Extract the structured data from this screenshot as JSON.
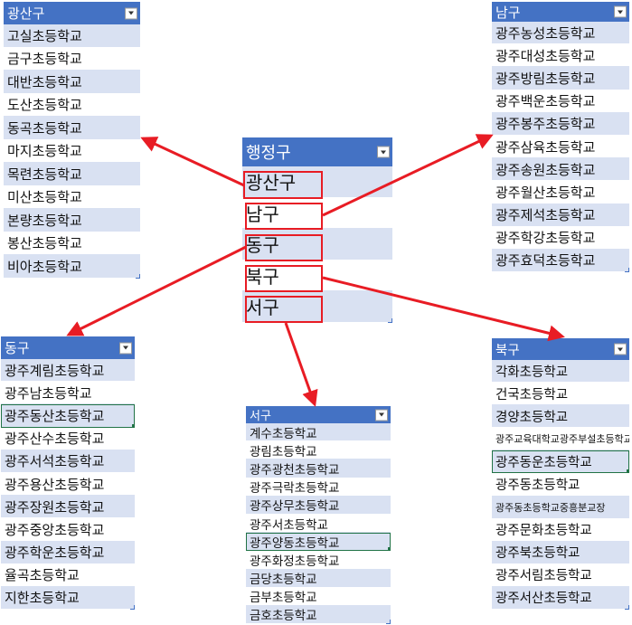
{
  "colors": {
    "header": "#4472c4",
    "band": "#d9e1f2",
    "arrow": "#e81c24",
    "selection": "#217346"
  },
  "icons": {
    "filter": "filter-dropdown-icon"
  },
  "tables": [
    {
      "id": "gwangsan",
      "header": "광산구",
      "rows": [
        "고실초등학교",
        "금구초등학교",
        "대반초등학교",
        "도산초등학교",
        "동곡초등학교",
        "마지초등학교",
        "목련초등학교",
        "미산초등학교",
        "본량초등학교",
        "봉산초등학교",
        "비아초등학교"
      ]
    },
    {
      "id": "nam",
      "header": "남구",
      "rows": [
        "광주농성초등학교",
        "광주대성초등학교",
        "광주방림초등학교",
        "광주백운초등학교",
        "광주봉주초등학교",
        "광주삼육초등학교",
        "광주송원초등학교",
        "광주월산초등학교",
        "광주제석초등학교",
        "광주학강초등학교",
        "광주효덕초등학교"
      ]
    },
    {
      "id": "district",
      "header": "행정구",
      "rows": [
        "광산구",
        "남구",
        "동구",
        "북구",
        "서구"
      ]
    },
    {
      "id": "dong",
      "header": "동구",
      "rows": [
        "광주계림초등학교",
        "광주남초등학교",
        "광주동산초등학교",
        "광주산수초등학교",
        "광주서석초등학교",
        "광주용산초등학교",
        "광주장원초등학교",
        "광주중앙초등학교",
        "광주학운초등학교",
        "율곡초등학교",
        "지한초등학교"
      ]
    },
    {
      "id": "seo",
      "header": "서구",
      "rows": [
        "계수초등학교",
        "광림초등학교",
        "광주광천초등학교",
        "광주극락초등학교",
        "광주상무초등학교",
        "광주서초등학교",
        "광주양동초등학교",
        "광주화정초등학교",
        "금당초등학교",
        "금부초등학교",
        "금호초등학교"
      ]
    },
    {
      "id": "buk",
      "header": "북구",
      "rows": [
        "각화초등학교",
        "건국초등학교",
        "경양초등학교",
        "광주교육대학교광주부설초등학교",
        "광주동운초등학교",
        "광주동초등학교",
        "광주동초등학교중흥분교장",
        "광주문화초등학교",
        "광주북초등학교",
        "광주서림초등학교",
        "광주서산초등학교"
      ]
    }
  ]
}
